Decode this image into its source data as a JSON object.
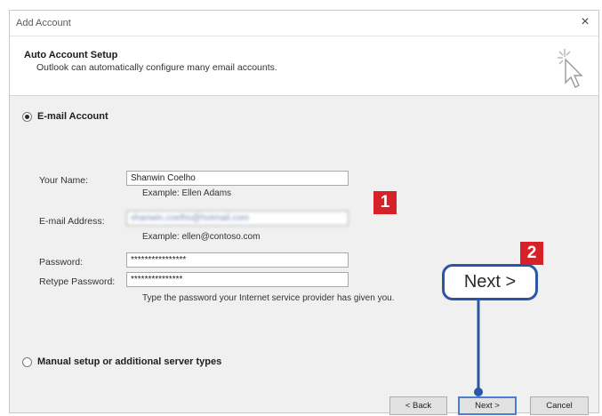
{
  "window": {
    "title": "Add Account",
    "close_glyph": "×"
  },
  "header": {
    "title": "Auto Account Setup",
    "subtitle": "Outlook can automatically configure many email accounts.",
    "icon": "wizard-cursor-icon"
  },
  "options": {
    "email_account_label": "E-mail Account",
    "manual_setup_label": "Manual setup or additional server types"
  },
  "form": {
    "name_label": "Your Name:",
    "name_value": "Shanwin Coelho",
    "name_hint": "Example: Ellen Adams",
    "email_label": "E-mail Address:",
    "email_value": "shanwin.coelho@hotmail.com",
    "email_hint": "Example: ellen@contoso.com",
    "password_label": "Password:",
    "password_value": "****************",
    "retype_label": "Retype Password:",
    "retype_value": "***************",
    "password_hint": "Type the password your Internet service provider has given you."
  },
  "buttons": {
    "back": "< Back",
    "next": "Next >",
    "cancel": "Cancel"
  },
  "annotations": {
    "badge1": "1",
    "badge2": "2",
    "callout": "Next >"
  },
  "colors": {
    "badge": "#d62128",
    "callout_border": "#2a56a4",
    "dialog_bg": "#f0f0f0"
  }
}
